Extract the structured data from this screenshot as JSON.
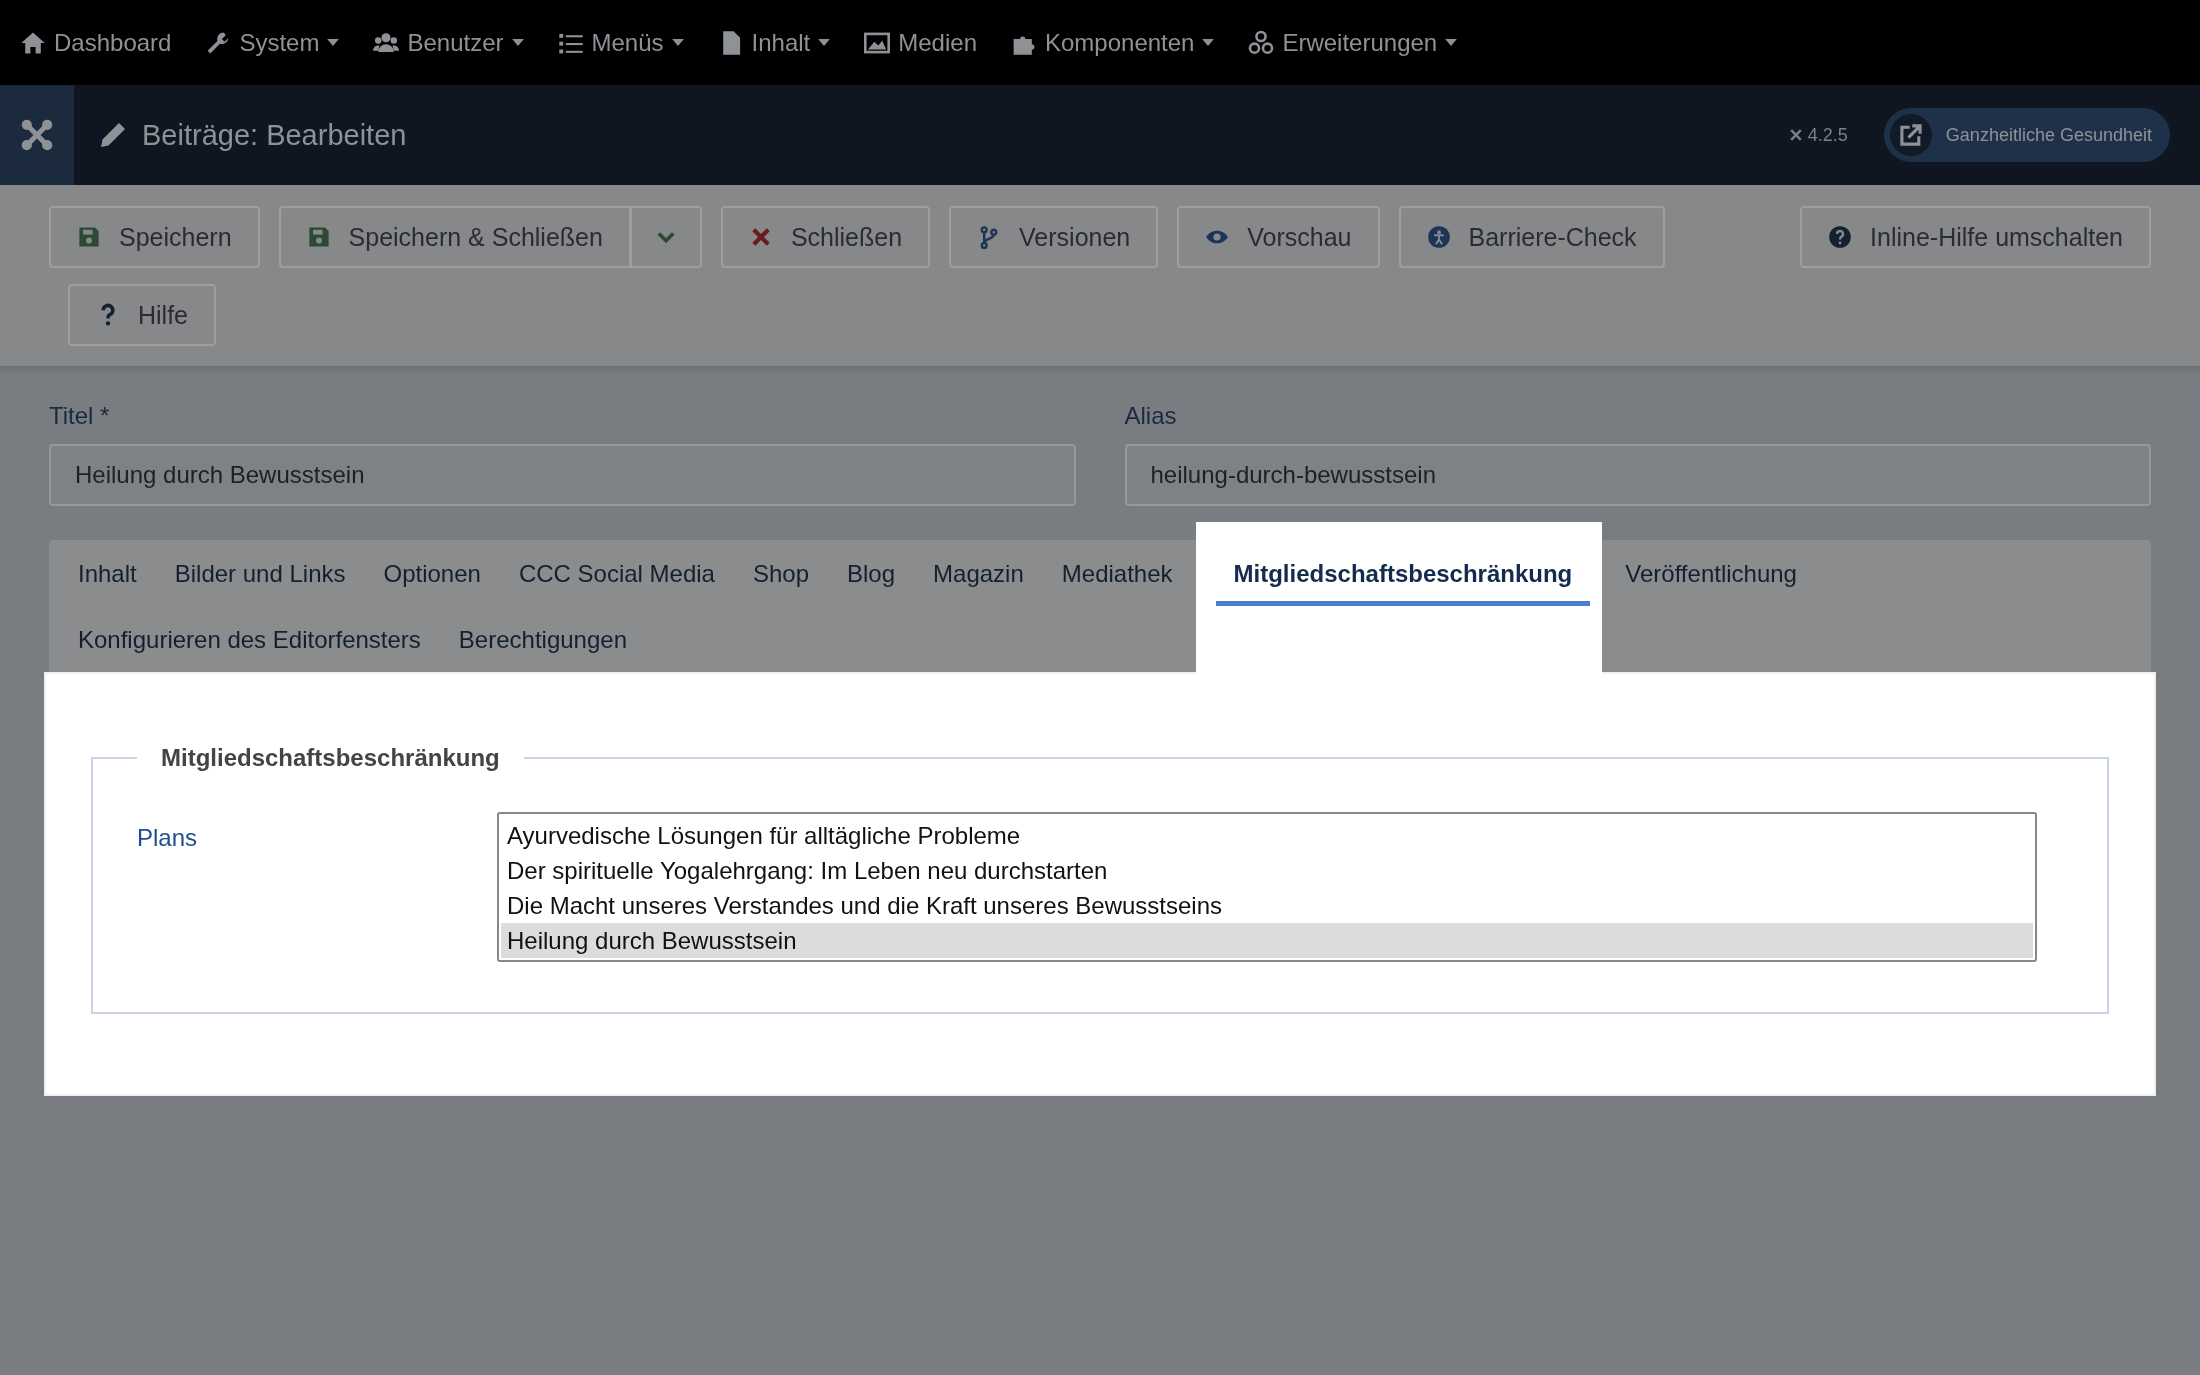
{
  "top_nav": [
    {
      "label": "Dashboard",
      "has_caret": false
    },
    {
      "label": "System",
      "has_caret": true
    },
    {
      "label": "Benutzer",
      "has_caret": true
    },
    {
      "label": "Menüs",
      "has_caret": true
    },
    {
      "label": "Inhalt",
      "has_caret": true
    },
    {
      "label": "Medien",
      "has_caret": false
    },
    {
      "label": "Komponenten",
      "has_caret": true
    },
    {
      "label": "Erweiterungen",
      "has_caret": true
    }
  ],
  "header": {
    "title": "Beiträge: Bearbeiten",
    "version": "4.2.5",
    "site_button": "Ganzheitliche Gesundheit"
  },
  "toolbar": {
    "buttons": [
      {
        "label": "Speichern"
      },
      {
        "label": "Speichern & Schließen"
      },
      {
        "label": "Schließen"
      },
      {
        "label": "Versionen"
      },
      {
        "label": "Vorschau"
      },
      {
        "label": "Barriere-Check"
      }
    ],
    "inline_help": "Inline-Hilfe umschalten",
    "help": "Hilfe"
  },
  "fields": [
    {
      "label": "Titel *",
      "value": "Heilung durch Bewusstsein"
    },
    {
      "label": "Alias",
      "value": "heilung-durch-bewusstsein"
    }
  ],
  "tabs": [
    {
      "label": "Inhalt",
      "selected": false
    },
    {
      "label": "Bilder und Links",
      "selected": false
    },
    {
      "label": "Optionen",
      "selected": false
    },
    {
      "label": "CCC Social Media",
      "selected": false
    },
    {
      "label": "Shop",
      "selected": false
    },
    {
      "label": "Blog",
      "selected": false
    },
    {
      "label": "Magazin",
      "selected": false
    },
    {
      "label": "Mediathek",
      "selected": false
    },
    {
      "label": "Mitgliedschaftsbeschränkung",
      "selected": true
    },
    {
      "label": "Veröffentlichung",
      "selected": false
    },
    {
      "label": "Konfigurieren des Editorfensters",
      "selected": false
    },
    {
      "label": "Berechtigungen",
      "selected": false
    }
  ],
  "fieldset": {
    "legend": "Mitgliedschaftsbeschränkung",
    "field_label": "Plans",
    "options": [
      {
        "label": "Ayurvedische Lösungen für alltägliche Probleme",
        "selected": false
      },
      {
        "label": "Der spirituelle Yogalehrgang: Im Leben neu durchstarten",
        "selected": false
      },
      {
        "label": "Die Macht unseres Verstandes und die Kraft unseres Bewusstseins",
        "selected": false
      },
      {
        "label": "Heilung durch Bewusstsein",
        "selected": true
      }
    ]
  }
}
